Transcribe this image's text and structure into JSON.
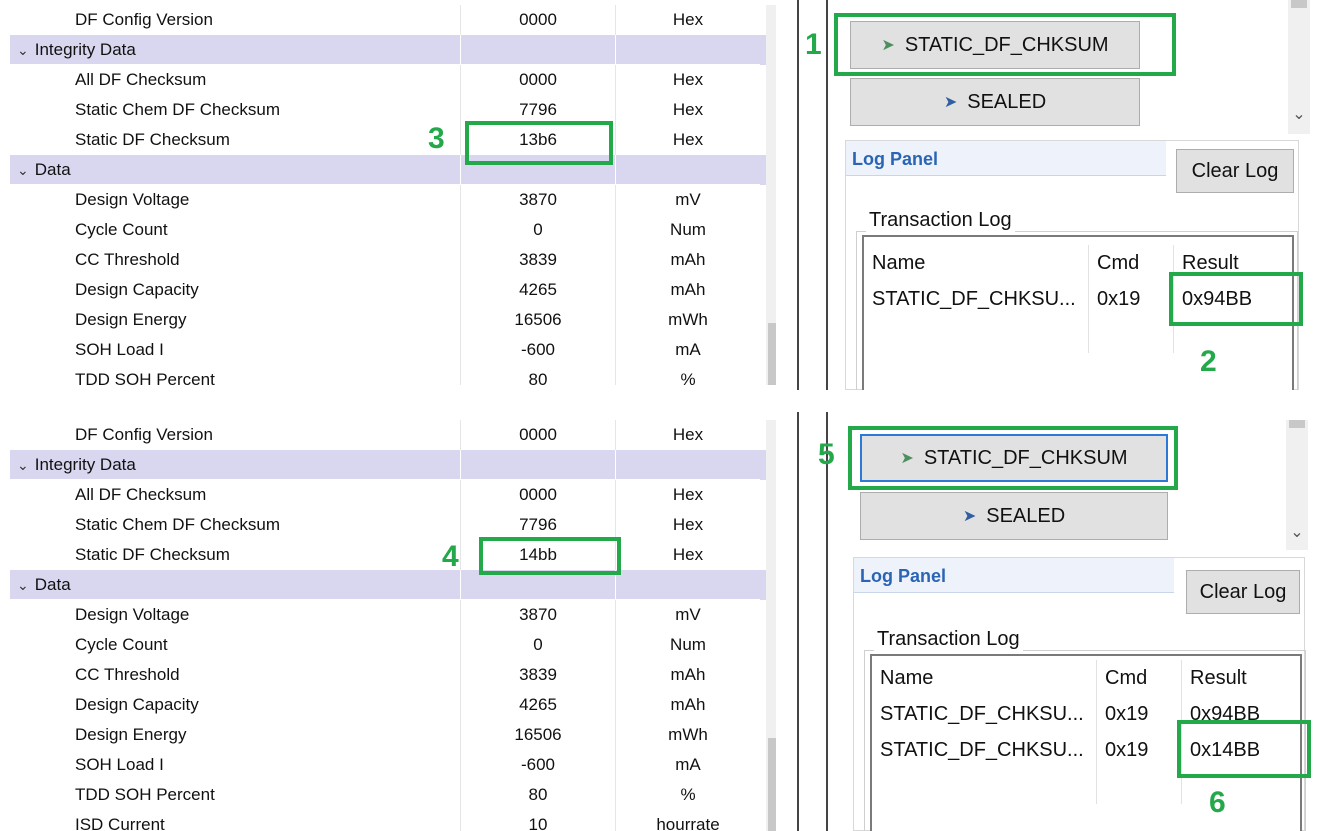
{
  "panels": [
    {
      "rows": [
        {
          "type": "item",
          "name": "DF Config Version",
          "value": "0000",
          "unit": "Hex"
        },
        {
          "type": "section",
          "name": "Integrity Data"
        },
        {
          "type": "item",
          "name": "All DF Checksum",
          "value": "0000",
          "unit": "Hex"
        },
        {
          "type": "item",
          "name": "Static Chem DF Checksum",
          "value": "7796",
          "unit": "Hex"
        },
        {
          "type": "item",
          "name": "Static DF Checksum",
          "value": "13b6",
          "unit": "Hex"
        },
        {
          "type": "section",
          "name": "Data"
        },
        {
          "type": "item",
          "name": "Design Voltage",
          "value": "3870",
          "unit": "mV"
        },
        {
          "type": "item",
          "name": "Cycle Count",
          "value": "0",
          "unit": "Num"
        },
        {
          "type": "item",
          "name": "CC Threshold",
          "value": "3839",
          "unit": "mAh"
        },
        {
          "type": "item",
          "name": "Design Capacity",
          "value": "4265",
          "unit": "mAh"
        },
        {
          "type": "item",
          "name": "Design Energy",
          "value": "16506",
          "unit": "mWh"
        },
        {
          "type": "item",
          "name": "SOH Load I",
          "value": "-600",
          "unit": "mA"
        },
        {
          "type": "item",
          "name": "TDD SOH Percent",
          "value": "80",
          "unit": "%"
        }
      ],
      "buttons": {
        "df_chksum": "STATIC_DF_CHKSUM",
        "sealed": "SEALED"
      },
      "log": {
        "title": "Log Panel",
        "clear": "Clear Log",
        "group": "Transaction Log",
        "headers": [
          "Name",
          "Cmd",
          "Result"
        ],
        "rows": [
          {
            "name": "STATIC_DF_CHKSU...",
            "cmd": "0x19",
            "result": "0x94BB"
          }
        ]
      },
      "callouts": {
        "button": "1",
        "result": "2",
        "value": "3"
      }
    },
    {
      "rows": [
        {
          "type": "item",
          "name": "DF Config Version",
          "value": "0000",
          "unit": "Hex"
        },
        {
          "type": "section",
          "name": "Integrity Data"
        },
        {
          "type": "item",
          "name": "All DF Checksum",
          "value": "0000",
          "unit": "Hex"
        },
        {
          "type": "item",
          "name": "Static Chem DF Checksum",
          "value": "7796",
          "unit": "Hex"
        },
        {
          "type": "item",
          "name": "Static DF Checksum",
          "value": "14bb",
          "unit": "Hex"
        },
        {
          "type": "section",
          "name": "Data"
        },
        {
          "type": "item",
          "name": "Design Voltage",
          "value": "3870",
          "unit": "mV"
        },
        {
          "type": "item",
          "name": "Cycle Count",
          "value": "0",
          "unit": "Num"
        },
        {
          "type": "item",
          "name": "CC Threshold",
          "value": "3839",
          "unit": "mAh"
        },
        {
          "type": "item",
          "name": "Design Capacity",
          "value": "4265",
          "unit": "mAh"
        },
        {
          "type": "item",
          "name": "Design Energy",
          "value": "16506",
          "unit": "mWh"
        },
        {
          "type": "item",
          "name": "SOH Load I",
          "value": "-600",
          "unit": "mA"
        },
        {
          "type": "item",
          "name": "TDD SOH Percent",
          "value": "80",
          "unit": "%"
        },
        {
          "type": "item",
          "name": "ISD Current",
          "value": "10",
          "unit": "hourrate"
        }
      ],
      "buttons": {
        "df_chksum": "STATIC_DF_CHKSUM",
        "sealed": "SEALED"
      },
      "log": {
        "title": "Log Panel",
        "clear": "Clear Log",
        "group": "Transaction Log",
        "headers": [
          "Name",
          "Cmd",
          "Result"
        ],
        "rows": [
          {
            "name": "STATIC_DF_CHKSU...",
            "cmd": "0x19",
            "result": "0x94BB"
          },
          {
            "name": "STATIC_DF_CHKSU...",
            "cmd": "0x19",
            "result": "0x14BB"
          }
        ]
      },
      "callouts": {
        "button": "5",
        "value": "4",
        "result": "6"
      }
    }
  ],
  "icons": {
    "section_toggle": "chevron-down-icon",
    "df_button": "pin-icon",
    "sealed_button": "pin-icon"
  },
  "colors": {
    "section_bg": "#d9d7f0",
    "highlight": "#23a84a",
    "log_title": "#2a64b5",
    "focus_border": "#2b7bd6"
  }
}
